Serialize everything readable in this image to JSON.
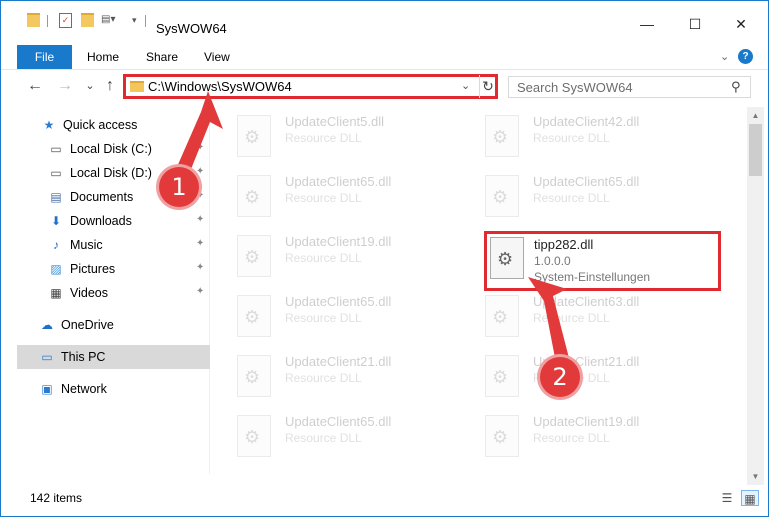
{
  "title_bar": {
    "title": "SysWOW64",
    "minimize_glyph": "—",
    "maximize_glyph": "☐",
    "close_glyph": "✕"
  },
  "ribbon": {
    "tabs": [
      "File",
      "Home",
      "Share",
      "View"
    ],
    "expand_glyph": "⌄",
    "help_glyph": "?"
  },
  "navigation": {
    "back_glyph": "←",
    "forward_glyph": "→",
    "recent_glyph": "⌄",
    "up_glyph": "↑",
    "address": "C:\\Windows\\SysWOW64",
    "address_dropdown_glyph": "⌄",
    "refresh_glyph": "↻",
    "search_placeholder": "Search SysWOW64",
    "search_glyph": "⚲"
  },
  "sidebar": {
    "items": [
      {
        "label": "Quick access",
        "icon": "star-icon",
        "glyph": "★",
        "color": "#2b7bd3",
        "pinned": false
      },
      {
        "label": "Local Disk (C:)",
        "icon": "drive-icon",
        "glyph": "▭",
        "color": "#555555",
        "pinned": true
      },
      {
        "label": "Local Disk (D:)",
        "icon": "drive-icon",
        "glyph": "▭",
        "color": "#555555",
        "pinned": true
      },
      {
        "label": "Documents",
        "icon": "documents-icon",
        "glyph": "▤",
        "color": "#4a6fa5",
        "pinned": true
      },
      {
        "label": "Downloads",
        "icon": "download-icon",
        "glyph": "⬇",
        "color": "#1e70c8",
        "pinned": true
      },
      {
        "label": "Music",
        "icon": "music-icon",
        "glyph": "♪",
        "color": "#1e70c8",
        "pinned": true
      },
      {
        "label": "Pictures",
        "icon": "pictures-icon",
        "glyph": "▨",
        "color": "#3a8fd6",
        "pinned": true
      },
      {
        "label": "Videos",
        "icon": "videos-icon",
        "glyph": "▦",
        "color": "#444444",
        "pinned": true
      },
      {
        "label": "OneDrive",
        "icon": "cloud-icon",
        "glyph": "☁",
        "color": "#1e70c8",
        "pinned": false
      },
      {
        "label": "This PC",
        "icon": "computer-icon",
        "glyph": "▭",
        "color": "#2b7bd3",
        "pinned": false
      },
      {
        "label": "Network",
        "icon": "network-icon",
        "glyph": "▣",
        "color": "#2b7bd3",
        "pinned": false
      }
    ],
    "pin_glyph": "✦"
  },
  "files": {
    "left_column": [
      {
        "name": "UpdateClient5.dll",
        "type": "Resource DLL"
      },
      {
        "name": "UpdateClient65.dll",
        "type": "Resource DLL"
      },
      {
        "name": "UpdateClient19.dll",
        "type": "Resource DLL"
      },
      {
        "name": "UpdateClient65.dll",
        "type": "Resource DLL"
      },
      {
        "name": "UpdateClient21.dll",
        "type": "Resource DLL"
      },
      {
        "name": "UpdateClient65.dll",
        "type": "Resource DLL"
      }
    ],
    "right_column": [
      {
        "name": "UpdateClient42.dll",
        "type": "Resource DLL"
      },
      {
        "name": "UpdateClient65.dll",
        "type": "Resource DLL"
      },
      {
        "name": "UpdateClient63.dll",
        "type": "Resource DLL"
      },
      {
        "name": "UpdateClient21.dll",
        "type": "Resource DLL"
      },
      {
        "name": "UpdateClient19.dll",
        "type": "Resource DLL"
      }
    ],
    "highlighted": {
      "name": "tipp282.dll",
      "version": "1.0.0.0",
      "description": "System-Einstellungen"
    },
    "gear_glyph": "⚙"
  },
  "status_bar": {
    "item_count": "142 items",
    "details_view_glyph": "☰",
    "icons_view_glyph": "▦"
  },
  "annotations": {
    "step1": "1",
    "step2": "2",
    "color": "#e02a2f"
  }
}
